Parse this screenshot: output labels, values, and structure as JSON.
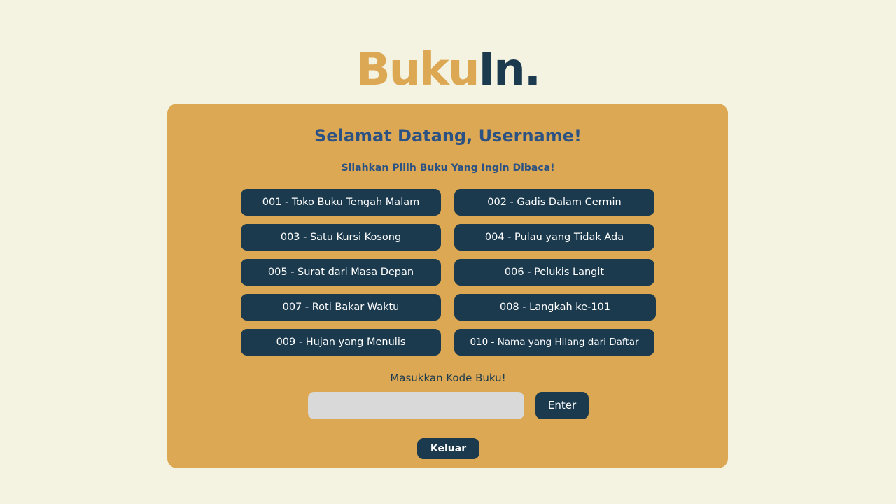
{
  "logo": {
    "part1": "Buku",
    "part2": "In",
    "dot": "."
  },
  "header": {
    "welcome": "Selamat Datang, Username!",
    "subtitle": "Silahkan Pilih Buku Yang Ingin Dibaca!"
  },
  "books": [
    {
      "label": "001 - Toko Buku Tengah Malam"
    },
    {
      "label": "002 - Gadis Dalam Cermin"
    },
    {
      "label": "003 - Satu Kursi Kosong"
    },
    {
      "label": "004 - Pulau yang Tidak Ada"
    },
    {
      "label": "005 - Surat dari Masa Depan"
    },
    {
      "label": "006 - Pelukis Langit"
    },
    {
      "label": "007 - Roti Bakar Waktu"
    },
    {
      "label": "008 - Langkah ke-101"
    },
    {
      "label": "009 - Hujan yang Menulis"
    },
    {
      "label": "010 - Nama yang Hilang dari Daftar"
    }
  ],
  "code_form": {
    "label": "Masukkan Kode Buku!",
    "input_value": "",
    "enter_label": "Enter"
  },
  "logout_label": "Keluar",
  "colors": {
    "background": "#f4f2e0",
    "accent": "#dca853",
    "primary": "#1b3a4e",
    "heading": "#2b5283",
    "input_bg": "#d9d9d9"
  }
}
